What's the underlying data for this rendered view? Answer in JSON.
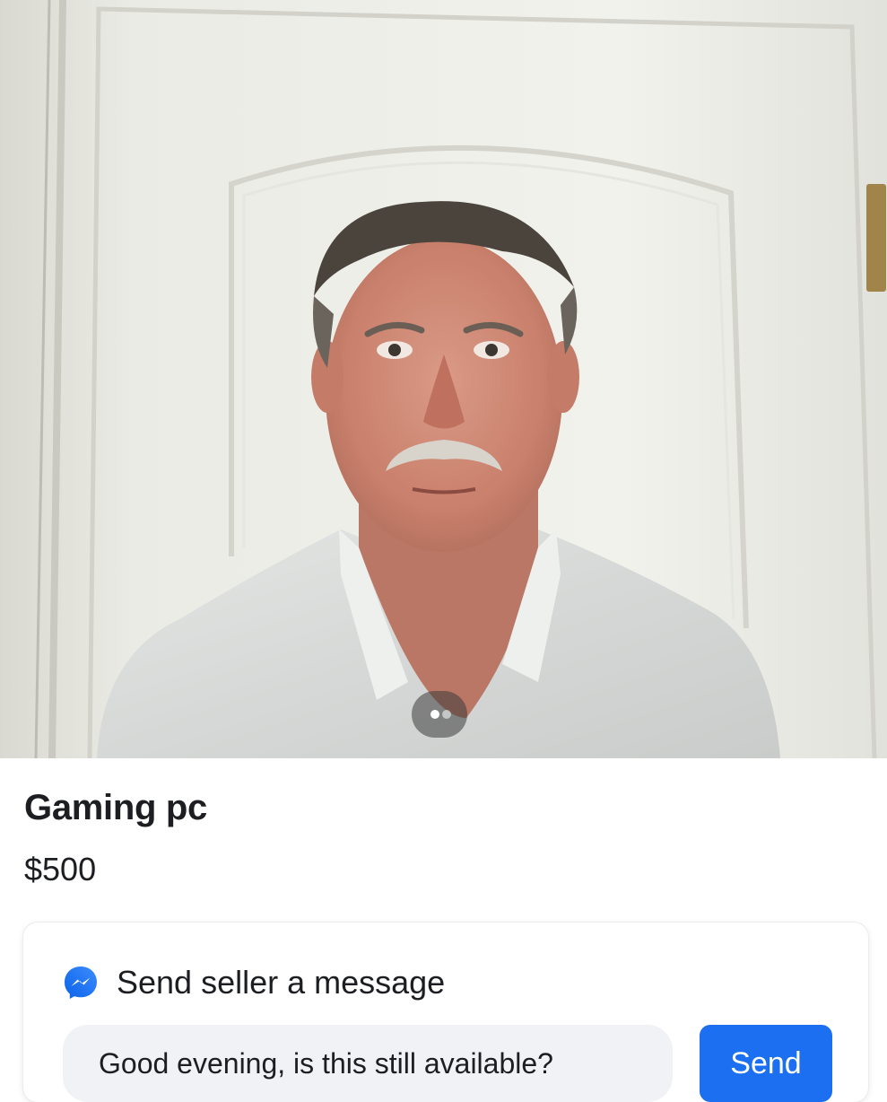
{
  "listing": {
    "title": "Gaming pc",
    "price": "$500",
    "photo_icon": "listing-photo"
  },
  "message": {
    "heading": "Send seller a message",
    "icon": "messenger-icon",
    "input_value": "Good evening, is this still available?",
    "send_label": "Send"
  },
  "colors": {
    "accent": "#1b6ff0",
    "input_background": "#f0f2f5",
    "text": "#1c1e21"
  }
}
